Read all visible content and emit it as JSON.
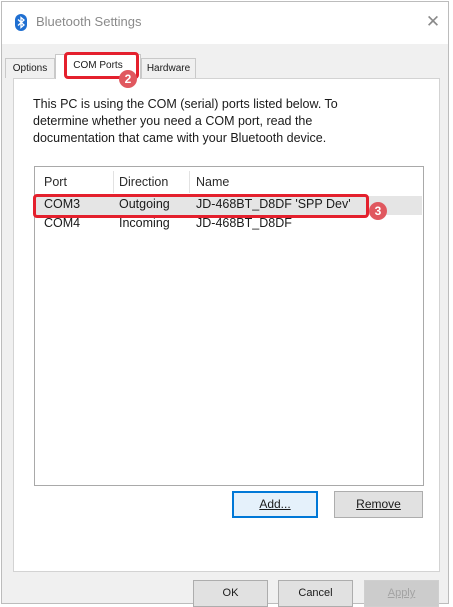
{
  "window": {
    "title": "Bluetooth Settings",
    "close_glyph": "✕",
    "icon": "bluetooth-icon"
  },
  "tabs": [
    {
      "label": "Options",
      "active": false
    },
    {
      "label": "COM Ports",
      "active": true
    },
    {
      "label": "Hardware",
      "active": false
    }
  ],
  "description": "This PC is using the COM (serial) ports listed below. To determine whether you need a COM port, read the documentation that came with your Bluetooth device.",
  "ports_table": {
    "headers": [
      "Port",
      "Direction",
      "Name"
    ],
    "rows": [
      {
        "port": "COM3",
        "direction": "Outgoing",
        "name": "JD-468BT_D8DF 'SPP Dev'",
        "selected": true
      },
      {
        "port": "COM4",
        "direction": "Incoming",
        "name": "JD-468BT_D8DF",
        "selected": false
      }
    ]
  },
  "buttons": {
    "add": "Add...",
    "remove": "Remove",
    "ok": "OK",
    "cancel": "Cancel",
    "apply": "Apply"
  },
  "annotations": {
    "step2": "2",
    "step3": "3",
    "highlight_color": "#e4202d",
    "badge_color": "#e0585f"
  },
  "colors": {
    "accent": "#0078d7",
    "selection": "#e5e5e5"
  }
}
